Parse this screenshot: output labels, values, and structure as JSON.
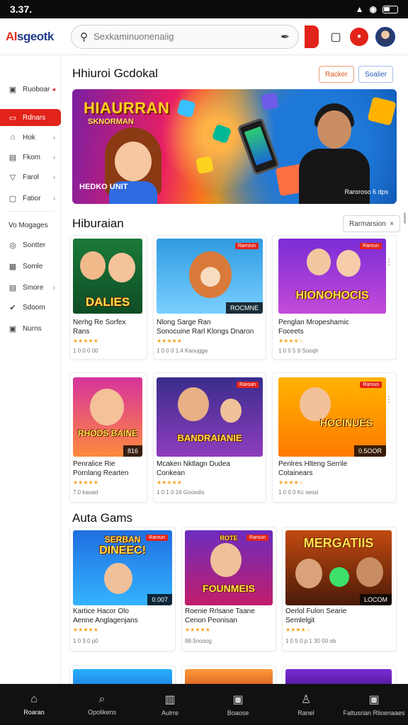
{
  "status": {
    "time": "3.37.",
    "signal": "❙❚❙",
    "wifi": "◠"
  },
  "header": {
    "logo_a": "Al",
    "logo_b": "sgeotk",
    "search_placeholder": "Sexkaminuonenaiig"
  },
  "sidebar": {
    "items": [
      {
        "label": "Ruoboar",
        "icon": "bookmark-icon",
        "glyph": "▣",
        "chevron": "◂"
      },
      {
        "label": "Rdnars",
        "icon": "flame-icon",
        "glyph": "▭",
        "active": true
      },
      {
        "label": "Hok",
        "icon": "bell-icon",
        "glyph": "⌂",
        "chevron": "›"
      },
      {
        "label": "Fkom",
        "icon": "calendar-icon",
        "glyph": "▤",
        "chevron": "›"
      },
      {
        "label": "Farol",
        "icon": "filter-icon",
        "glyph": "▽",
        "chevron": "›"
      },
      {
        "label": "Fatior",
        "icon": "folder-icon",
        "glyph": "▢",
        "chevron": "›"
      },
      {
        "label": "Vo Mogages",
        "icon": "none",
        "glyph": ""
      },
      {
        "label": "Sontter",
        "icon": "clock-icon",
        "glyph": "◎"
      },
      {
        "label": "Somle",
        "icon": "calendar-icon",
        "glyph": "▦"
      },
      {
        "label": "Smore",
        "icon": "photo-icon",
        "glyph": "▤",
        "chevron": "›"
      },
      {
        "label": "Sdoom",
        "icon": "check-icon",
        "glyph": "✔"
      },
      {
        "label": "Nurns",
        "icon": "store-icon",
        "glyph": "▣"
      }
    ]
  },
  "main": {
    "top_title": "Hhiuroi Gcdokal",
    "top_btn_1": "Racker",
    "top_btn_2": "Soalier",
    "banner": {
      "title": "HIAURRAN",
      "subtitle": "SKNORMAN",
      "badge": "HEDKO UNIT",
      "caption": "Raroroso 6 dps"
    },
    "section1": {
      "title": "Hiburaian",
      "filter": "Rarmarsion"
    },
    "cards_row1": [
      {
        "word": "DALIES",
        "tag": "",
        "label": "",
        "title_1": "Nerhg Re Sorfex",
        "title_2": "Rans",
        "stars": "★★★★★",
        "meta": "1 0.0 0 00"
      },
      {
        "word": "",
        "tag": "Rarroun",
        "label": "ROCMNE",
        "title_1": "Nlong Sarge Ran",
        "title_2": "Sonocuine Rarl Klongs Dnaron",
        "stars": "★★★★★",
        "meta": "1 0 0 0  1.4 Kaougga"
      },
      {
        "word": "HIONOHOCIS",
        "tag": "Raroun",
        "label": "",
        "title_1": "Penglan Mropeshamic",
        "title_2": "Foceets",
        "stars": "★★★★☆",
        "meta": "1 0 0  5 9 Sooqh"
      }
    ],
    "cards_row2": [
      {
        "word": "RHODS BAINE",
        "tag": "",
        "label": "816",
        "title_1": "Penralice Rie",
        "title_2": "Pornlang Rearten",
        "stars": "★★★★★",
        "meta": "7.0 kaoad"
      },
      {
        "word": "BANDRAIANIE",
        "tag": "Raroan",
        "label": "",
        "title_1": "Mcaken Nktlagn Dudea",
        "title_2": "Conkean",
        "stars": "★★★★★",
        "meta": "1 0 1 0  16 Gooodis"
      },
      {
        "word": "HOCINUES",
        "tag": "Rarous",
        "label": "0.5OOR",
        "title_1": "Penlres Hlteng Serrile",
        "title_2": "Cotainears",
        "stars": "★★★★☆",
        "meta": "1 0 0 0  Kc oeod"
      }
    ],
    "section2": {
      "title": "Auta Gams"
    },
    "cards_row3": [
      {
        "word": "DINEEC!",
        "word_top": "SERBAN",
        "tag": "Raroun",
        "label": "0.007",
        "title_1": "Kartice Hacor Olo",
        "title_2": "Aenne Anglagenjans",
        "stars": "★★★★★",
        "meta": "1 0 3 0   p0"
      },
      {
        "word": "FOUNMEIS",
        "word_top": "ROTE",
        "tag": "Raroun",
        "label": "",
        "title_1": "Roenie Rrlsane Taane",
        "title_2": "Cenon Peonisan",
        "stars": "★★★★★",
        "meta": "98.5nooog"
      },
      {
        "word": "MERGATIIS",
        "tag": "",
        "label": "LOCOM",
        "title_1": "Oerlol Fulon Searie",
        "title_2": "Semlelgit",
        "stars": "★★★★☆",
        "meta": "1 0 5 0 p  1 30 00 ob"
      }
    ]
  },
  "bottom_nav": [
    {
      "label": "Roaran",
      "icon": "home-icon",
      "glyph": "⌂"
    },
    {
      "label": "Opolikens",
      "icon": "search-icon",
      "glyph": "⌕"
    },
    {
      "label": "Aulrre",
      "icon": "store-icon",
      "glyph": "▥"
    },
    {
      "label": "Boaose",
      "icon": "calendar-icon",
      "glyph": "▣"
    },
    {
      "label": "Ranel",
      "icon": "user-icon",
      "glyph": "♙"
    },
    {
      "label": "Faltusrian Rlioenaaes",
      "icon": "message-icon",
      "glyph": "▣"
    }
  ]
}
